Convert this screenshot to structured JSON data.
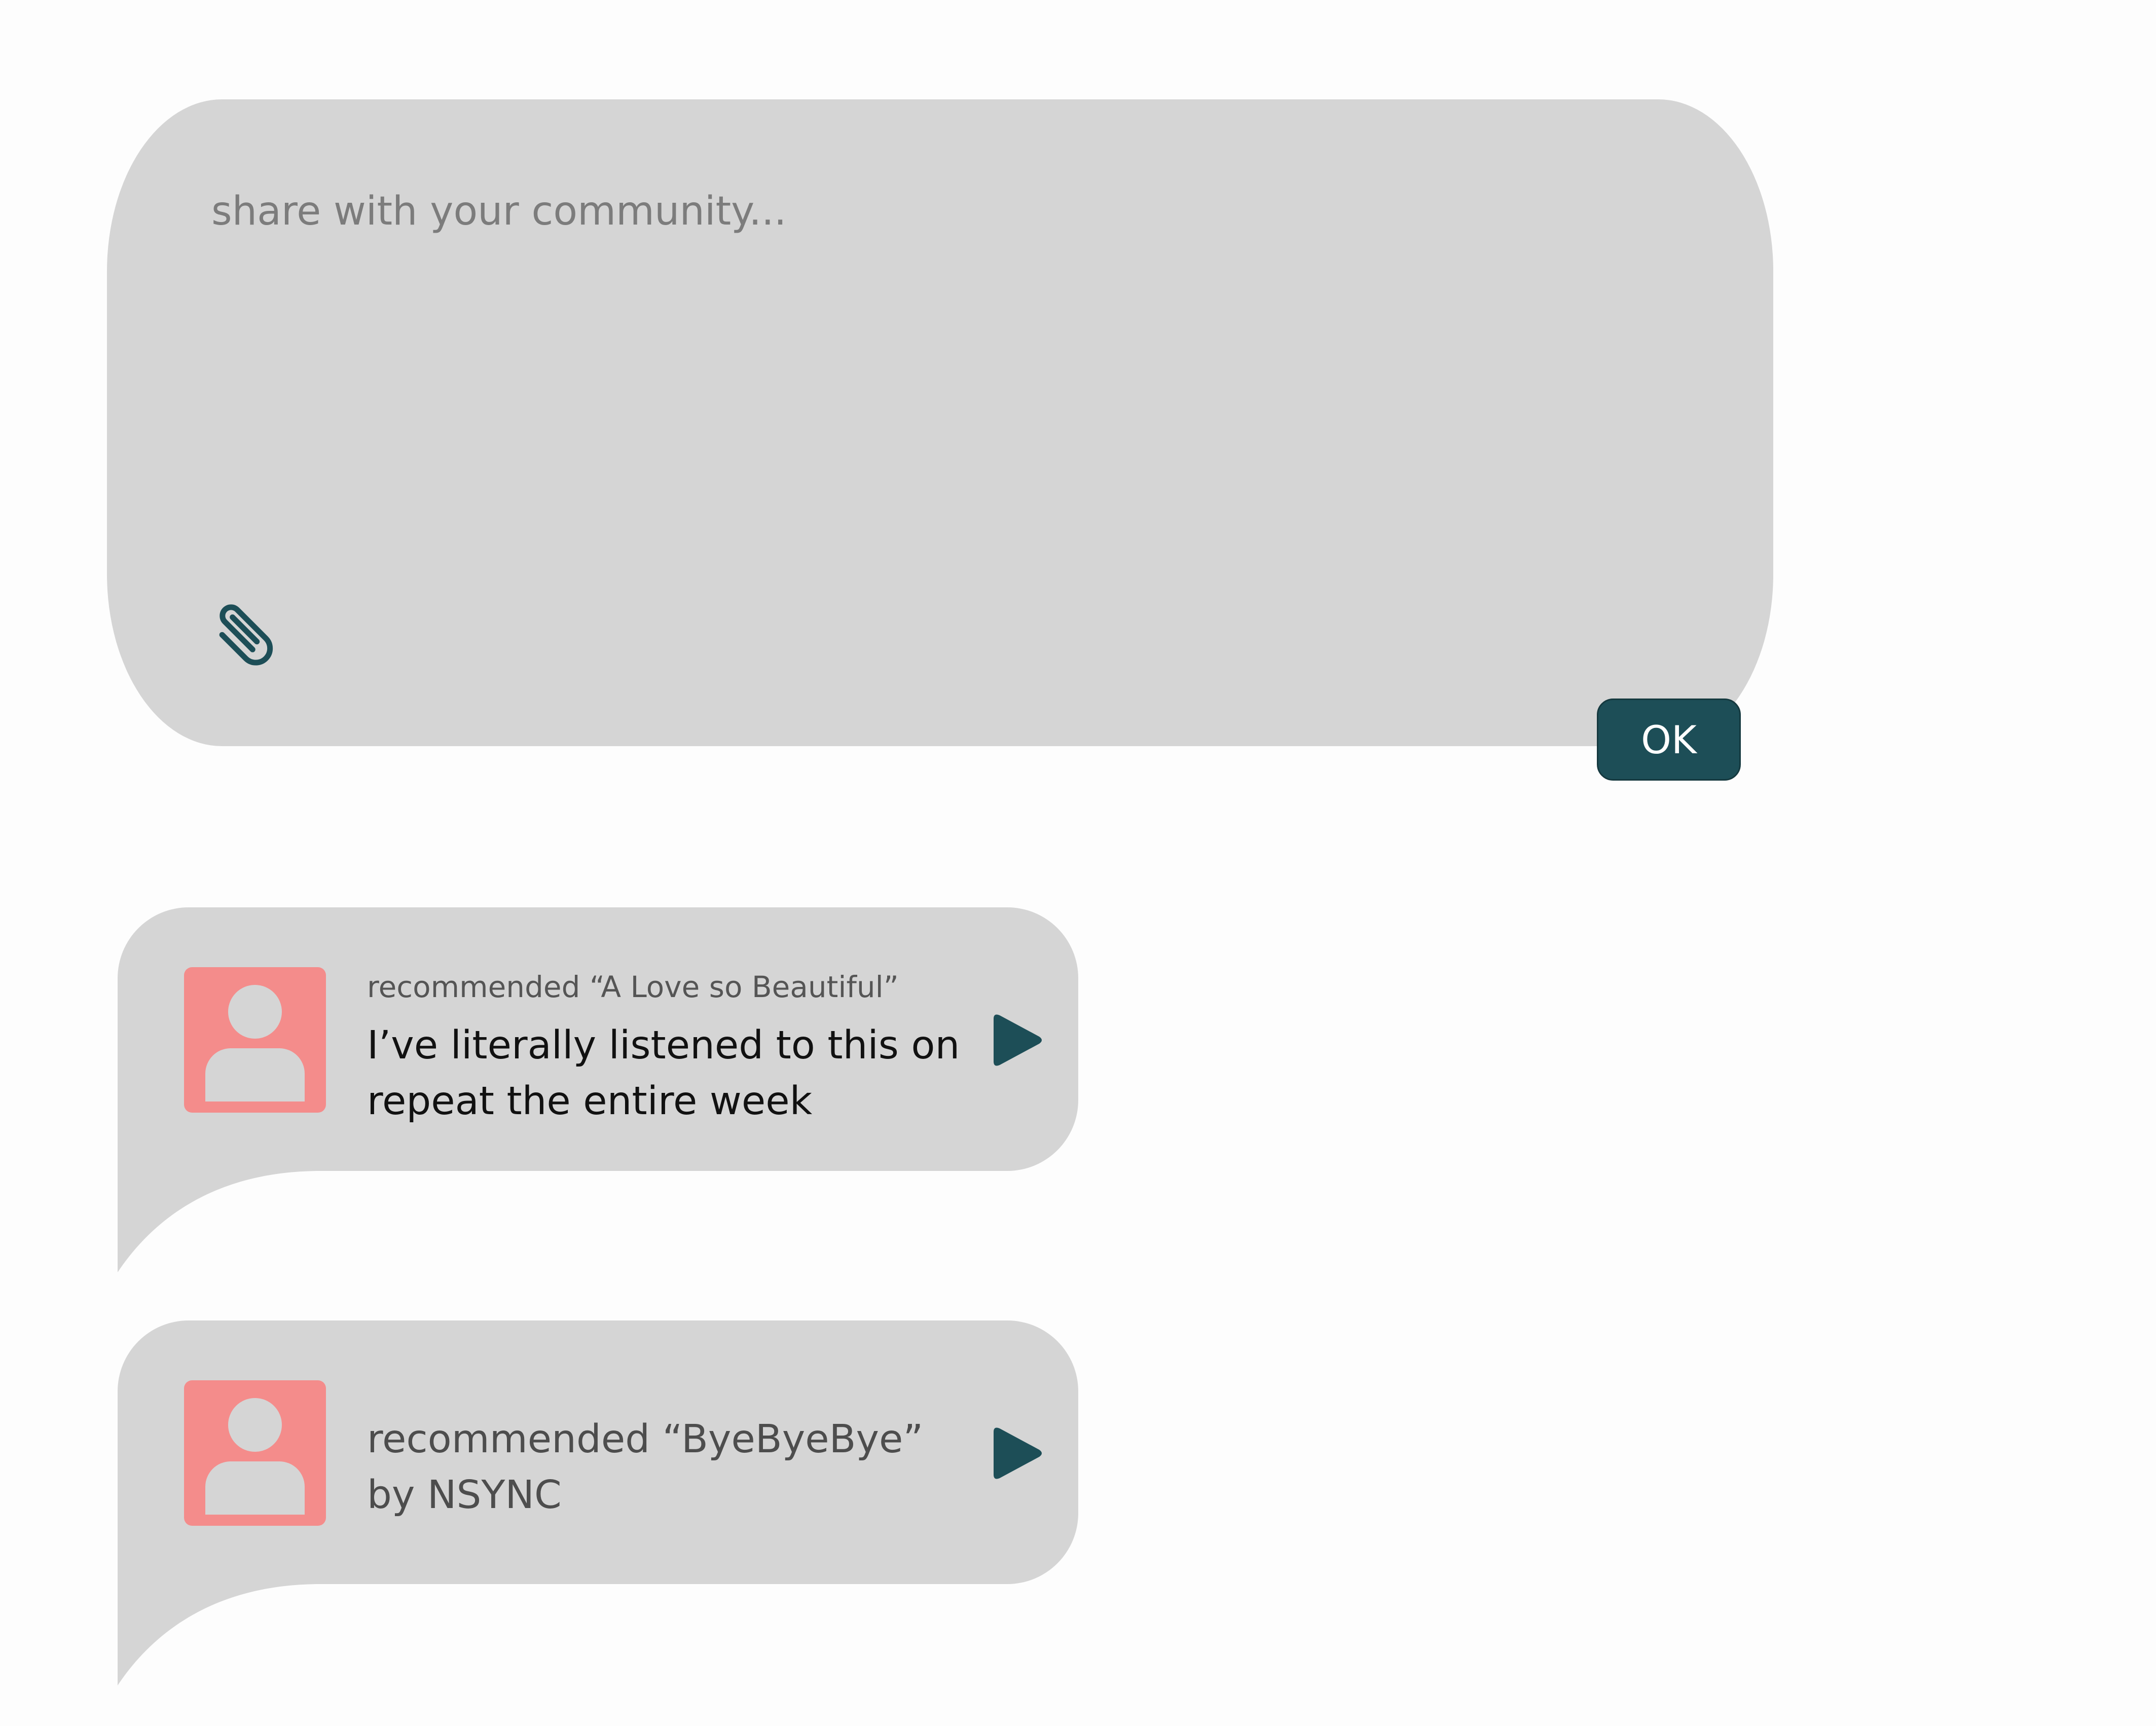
{
  "composer": {
    "placeholder": "share with your community...",
    "submit_label": "OK",
    "attach_icon": "paperclip-icon"
  },
  "feed": [
    {
      "meta": "recommended “A Love so Beautiful”",
      "body": "I’ve literally listened to this on repeat the entire week",
      "avatar_icon": "user-icon",
      "play_icon": "play-icon"
    },
    {
      "text": "recommended “ByeByeBye” by NSYNC",
      "avatar_icon": "user-icon",
      "play_icon": "play-icon"
    }
  ],
  "colors": {
    "accent": "#1d4e57",
    "bubble": "#d5d5d5",
    "avatar": "#f48c8b",
    "background": "#fdfdfd"
  }
}
